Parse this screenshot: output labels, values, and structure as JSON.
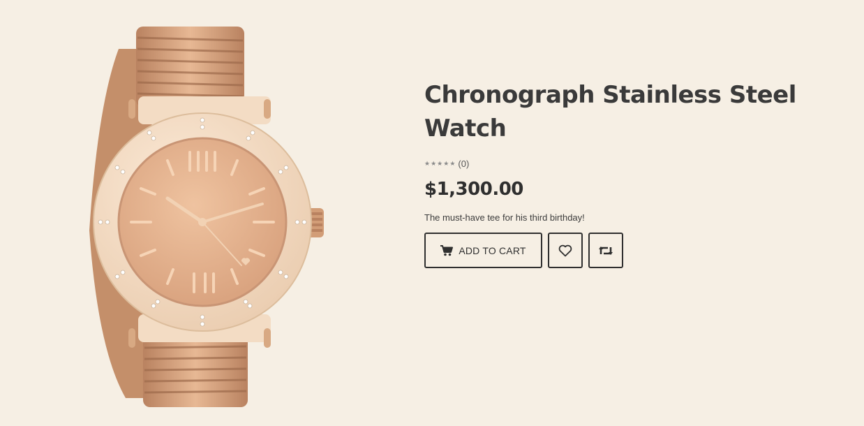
{
  "product": {
    "title": "Chronograph Stainless Steel Watch",
    "rating_count": "(0)",
    "rating_value": 0,
    "rating_max": 5,
    "price": "$1,300.00",
    "description": "The must-have tee for his third birthday!"
  },
  "actions": {
    "add_to_cart_label": "ADD TO CART",
    "add_to_cart_icon": "cart-icon",
    "wishlist_icon": "heart-icon",
    "compare_icon": "retweet-icon"
  },
  "colors": {
    "background": "#f6efe4",
    "text": "#3a3a3a",
    "border": "#2f2f2f",
    "watch_rose_gold": "#d9a57d"
  }
}
